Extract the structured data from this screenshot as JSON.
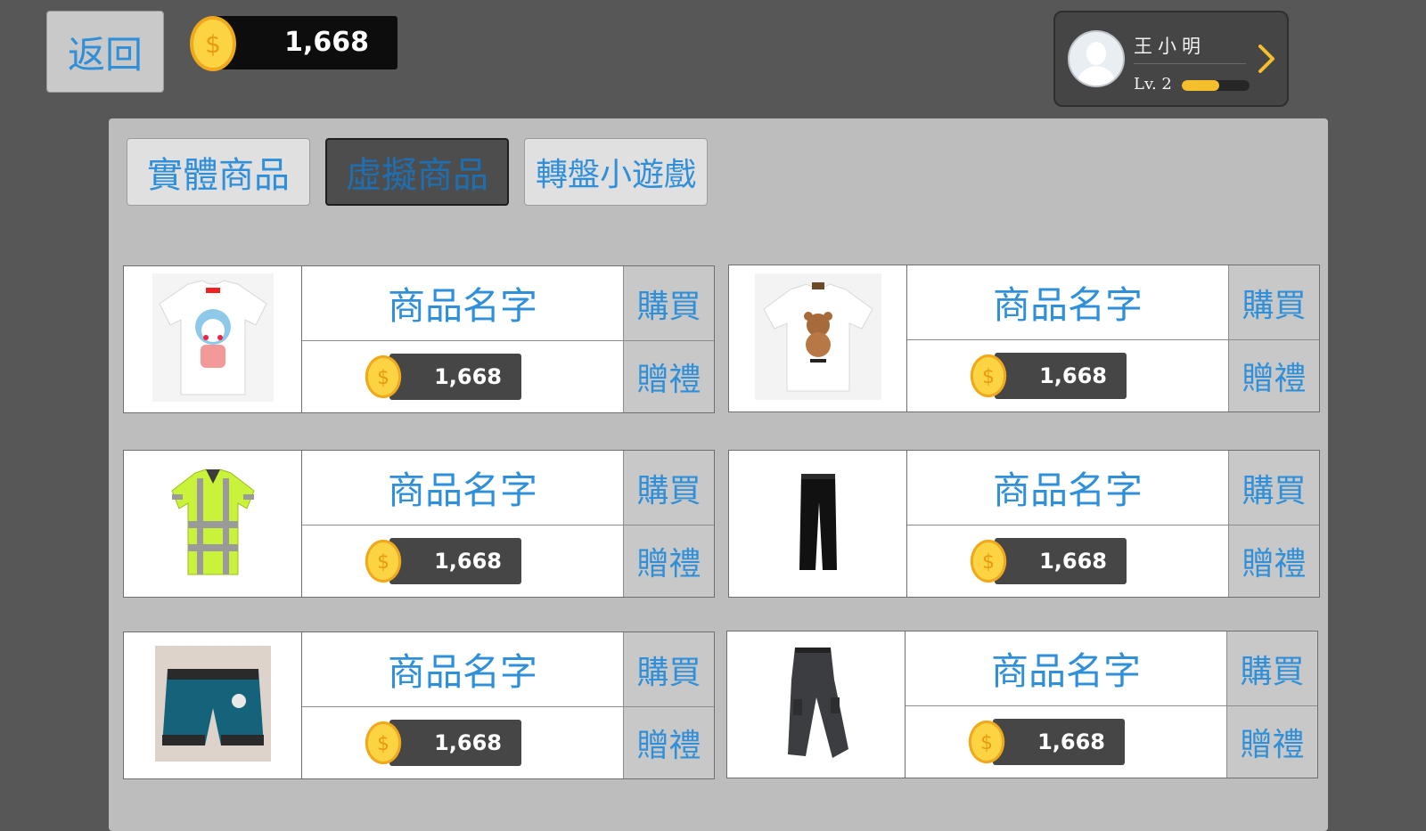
{
  "header": {
    "back_label": "返回",
    "coin_balance": "1,668"
  },
  "profile": {
    "name": "王小明",
    "level": "Lv. 2",
    "xp_fraction": 0.55
  },
  "tabs": [
    {
      "label": "實體商品",
      "active": false
    },
    {
      "label": "虛擬商品",
      "active": true
    },
    {
      "label": "轉盤小遊戲",
      "active": false
    }
  ],
  "products": [
    {
      "name": "商品名字",
      "price": "1,668",
      "buy_label": "購買",
      "gift_label": "贈禮",
      "image": "white-tshirt-doraemon-icon"
    },
    {
      "name": "商品名字",
      "price": "1,668",
      "buy_label": "購買",
      "gift_label": "贈禮",
      "image": "white-tshirt-teddy-bear-icon"
    },
    {
      "name": "商品名字",
      "price": "1,668",
      "buy_label": "購買",
      "gift_label": "贈禮",
      "image": "hi-vis-polo-shirt-icon"
    },
    {
      "name": "商品名字",
      "price": "1,668",
      "buy_label": "購買",
      "gift_label": "贈禮",
      "image": "black-trousers-icon"
    },
    {
      "name": "商品名字",
      "price": "1,668",
      "buy_label": "購買",
      "gift_label": "贈禮",
      "image": "teal-shorts-icon"
    },
    {
      "name": "商品名字",
      "price": "1,668",
      "buy_label": "購買",
      "gift_label": "贈禮",
      "image": "gray-cargo-pants-icon"
    }
  ],
  "colors": {
    "accent_blue": "#2f8fd8",
    "coin_gold": "#f5be2c",
    "background": "#585758"
  }
}
